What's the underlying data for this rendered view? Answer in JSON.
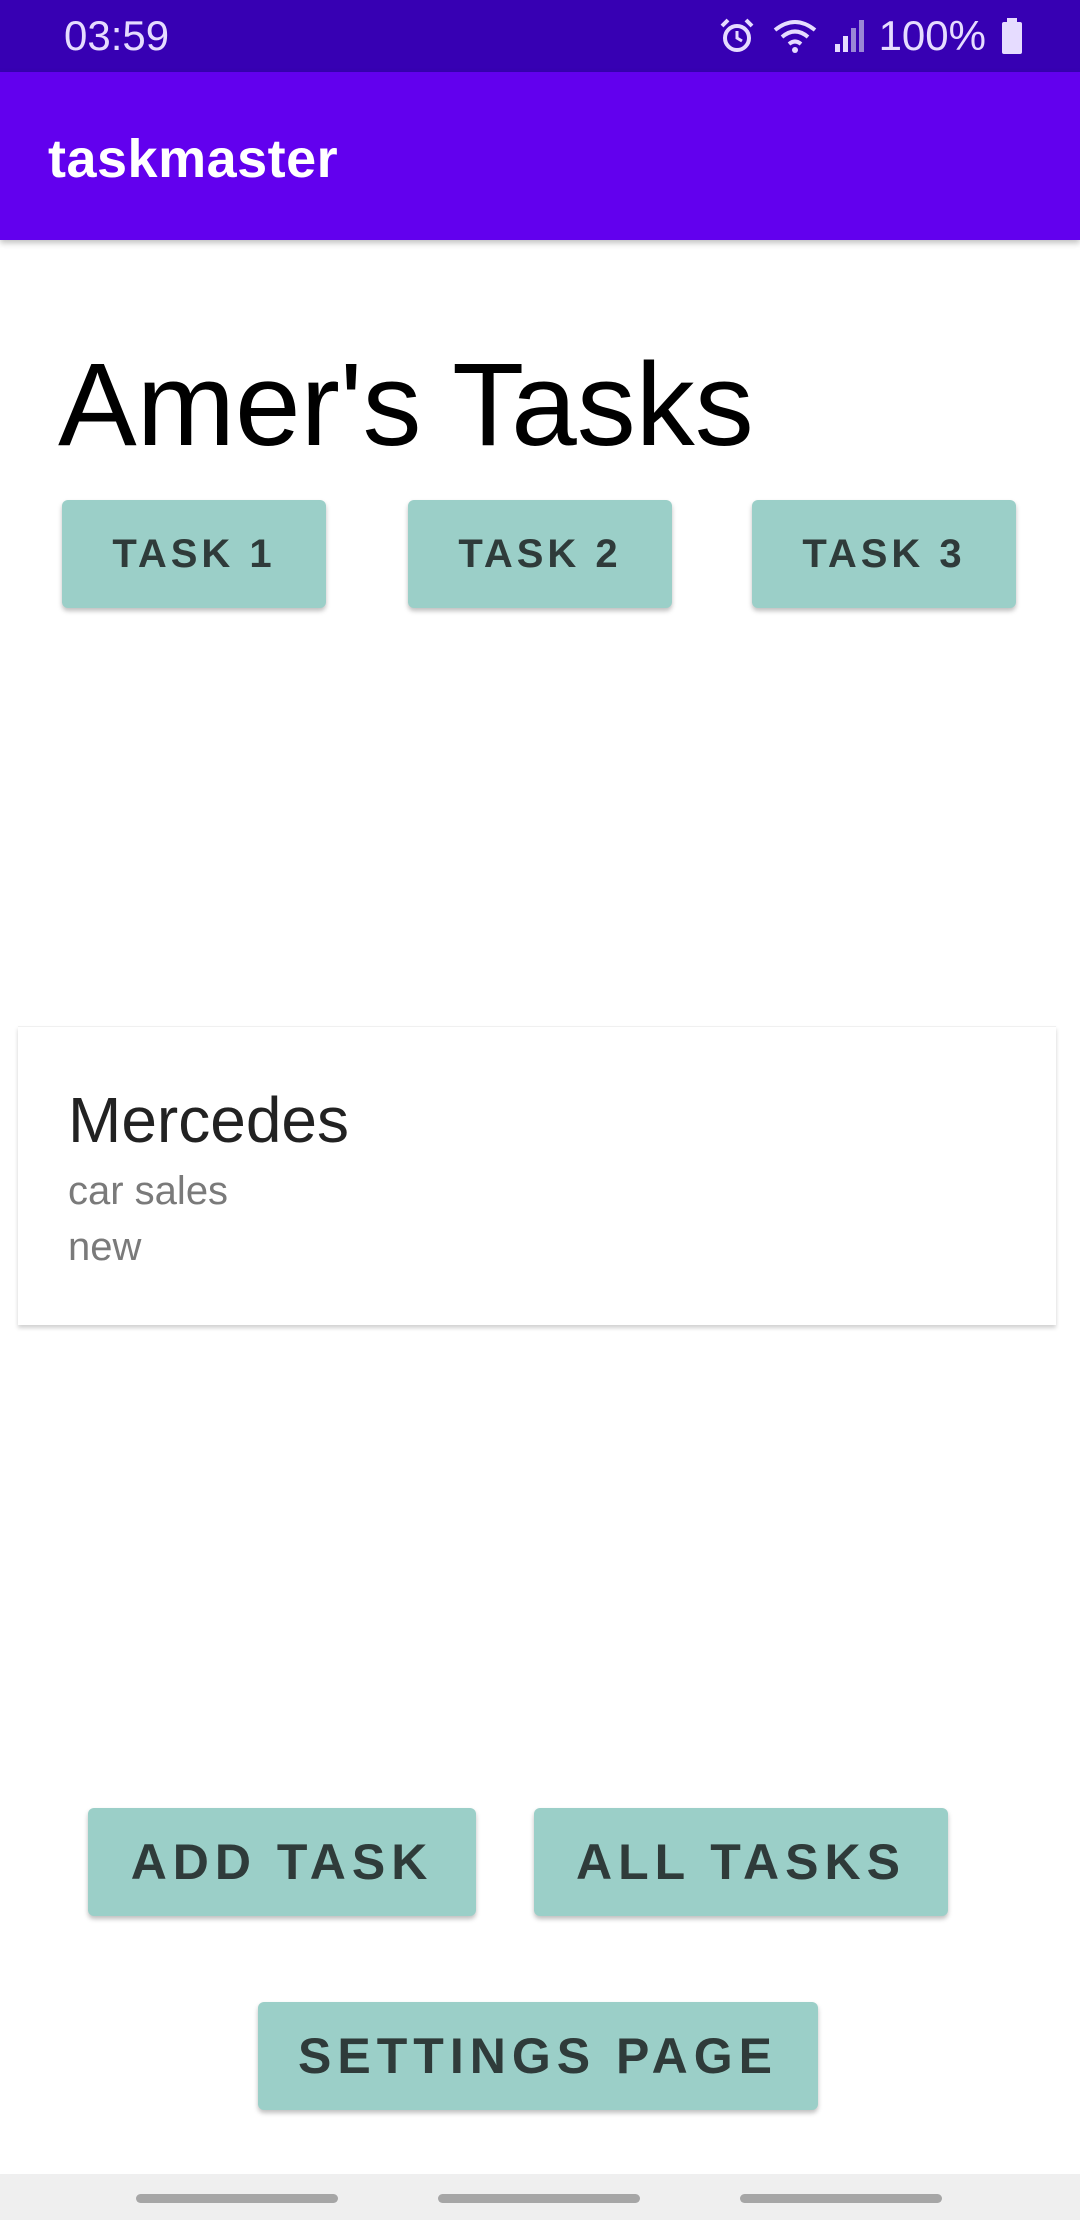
{
  "status_bar": {
    "time": "03:59",
    "battery": "100%",
    "icons": [
      "alarm-icon",
      "wifi-icon",
      "signal-icon",
      "battery-icon"
    ]
  },
  "app_bar": {
    "title": "taskmaster"
  },
  "main": {
    "heading": "Amer's Tasks",
    "task_buttons": [
      {
        "label": "TASK 1"
      },
      {
        "label": "TASK 2"
      },
      {
        "label": "TASK 3"
      }
    ],
    "task_list": [
      {
        "title": "Mercedes",
        "body": "car sales",
        "state": "new"
      }
    ]
  },
  "actions": {
    "add_task": "ADD TASK",
    "all_tasks": "ALL TASKS",
    "settings_page": "SETTINGS PAGE"
  },
  "colors": {
    "status_bar": "#3700b3",
    "app_bar": "#6200ee",
    "button": "#9bcfc8"
  }
}
